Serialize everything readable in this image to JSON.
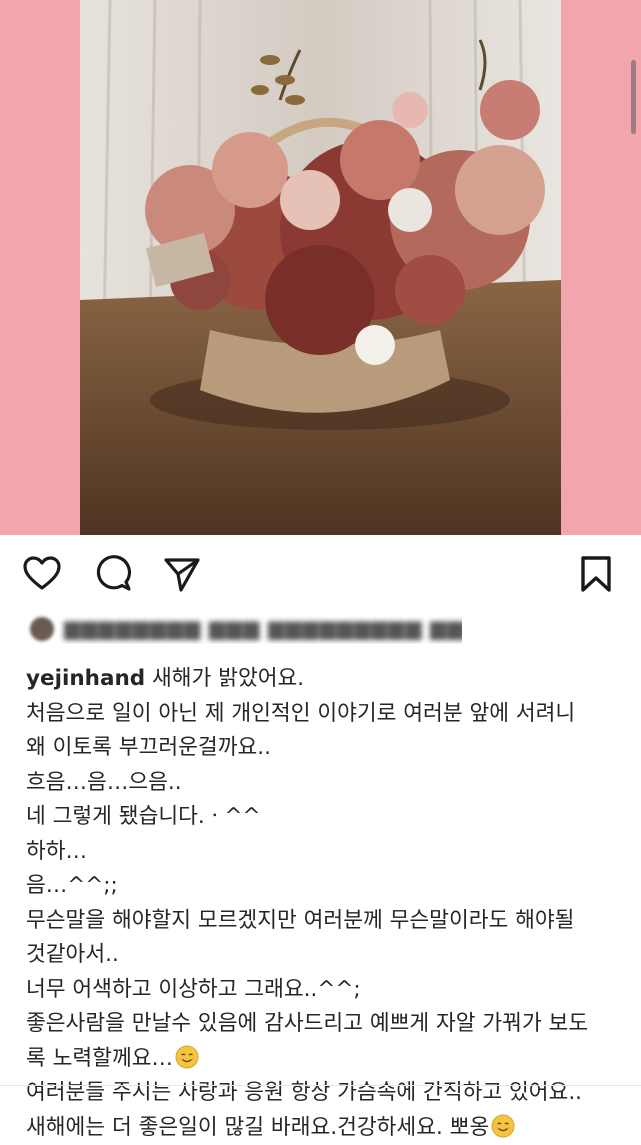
{
  "post": {
    "image_description_icon": "flower-basket-photo",
    "colors": {
      "frame": "#f2a5ad",
      "text": "#262626"
    }
  },
  "actions": {
    "like_icon": "heart-icon",
    "comment_icon": "comment-icon",
    "share_icon": "send-icon",
    "save_icon": "bookmark-icon"
  },
  "caption": {
    "username": "yejinhand",
    "lines": [
      "새해가 밝았어요.",
      "처음으로 일이 아닌 제 개인적인 이야기로 여러분 앞에 서려니",
      "왜 이토록 부끄러운걸까요..",
      "흐음…음…으음..",
      "네 그렇게 됐습니다.ㆍ^^",
      "하하…",
      "음…^^;;",
      "무슨말을 해야할지 모르겠지만 여러분께 무슨말이라도 해야될",
      "것같아서..",
      "너무 어색하고 이상하고 그래요..^^;",
      "좋은사람을 만날수 있음에 감사드리고 예쁘게 자알 가꿔가 보도",
      "록 노력할께요…",
      "여러분들 주시는 사랑과 응원 항상 가슴속에 간직하고 있어요..",
      "새해에는 더 좋은일이 많길 바래요.건강하세요. 뽀옹"
    ],
    "emoji": "smiling-face-icon"
  }
}
